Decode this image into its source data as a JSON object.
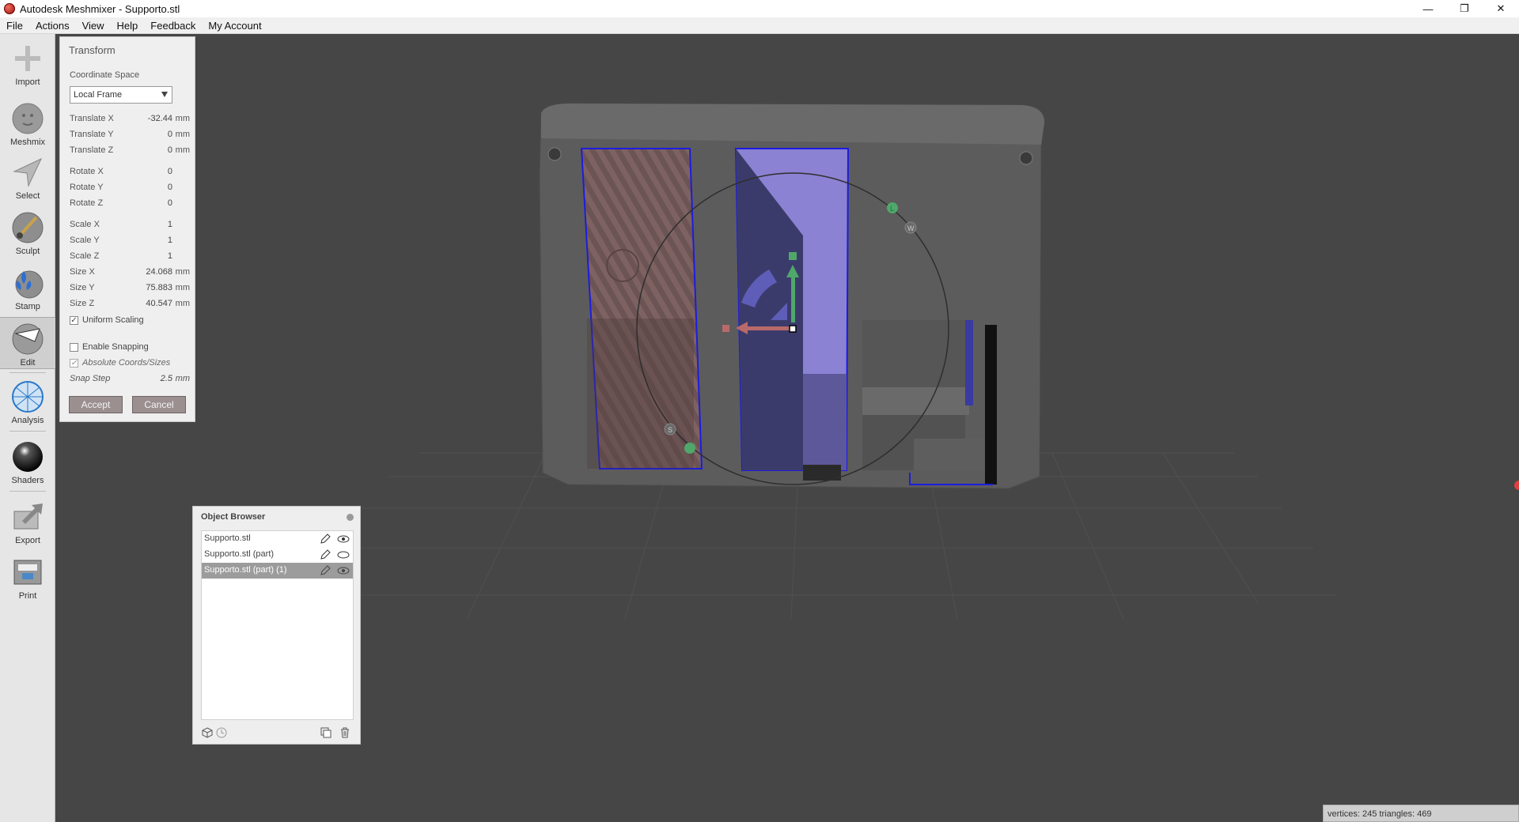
{
  "window": {
    "title": "Autodesk Meshmixer - Supporto.stl",
    "minimize": "—",
    "restore": "❐",
    "close": "✕"
  },
  "menu": [
    "File",
    "Actions",
    "View",
    "Help",
    "Feedback",
    "My Account"
  ],
  "toolbar": {
    "items": [
      {
        "label": "Import",
        "icon": "plus-icon"
      },
      {
        "label": "Meshmix",
        "icon": "face-sphere-icon"
      },
      {
        "label": "Select",
        "icon": "arrow-cursor-icon"
      },
      {
        "label": "Sculpt",
        "icon": "brush-sphere-icon"
      },
      {
        "label": "Stamp",
        "icon": "fleur-de-lis-icon"
      },
      {
        "label": "Edit",
        "icon": "edit-sphere-icon",
        "active": true
      },
      {
        "label": "Analysis",
        "icon": "wireframe-sphere-icon"
      },
      {
        "label": "Shaders",
        "icon": "black-sphere-icon"
      },
      {
        "label": "Export",
        "icon": "export-arrow-icon"
      },
      {
        "label": "Print",
        "icon": "printer-icon"
      }
    ]
  },
  "transform": {
    "title": "Transform",
    "coordinate_space_label": "Coordinate Space",
    "coordinate_space_value": "Local Frame",
    "rows": [
      {
        "label": "Translate X",
        "value": "-32.44",
        "unit": "mm"
      },
      {
        "label": "Translate Y",
        "value": "0",
        "unit": "mm"
      },
      {
        "label": "Translate Z",
        "value": "0",
        "unit": "mm"
      },
      {
        "label": "Rotate X",
        "value": "0",
        "unit": ""
      },
      {
        "label": "Rotate Y",
        "value": "0",
        "unit": ""
      },
      {
        "label": "Rotate Z",
        "value": "0",
        "unit": ""
      },
      {
        "label": "Scale X",
        "value": "1",
        "unit": ""
      },
      {
        "label": "Scale Y",
        "value": "1",
        "unit": ""
      },
      {
        "label": "Scale Z",
        "value": "1",
        "unit": ""
      },
      {
        "label": "Size X",
        "value": "24.068",
        "unit": "mm"
      },
      {
        "label": "Size Y",
        "value": "75.883",
        "unit": "mm"
      },
      {
        "label": "Size Z",
        "value": "40.547",
        "unit": "mm"
      }
    ],
    "uniform_scaling": {
      "label": "Uniform Scaling",
      "checked": true
    },
    "enable_snapping": {
      "label": "Enable Snapping",
      "checked": false
    },
    "absolute_coords": {
      "label": "Absolute Coords/Sizes",
      "checked": true
    },
    "snap_step": {
      "label": "Snap Step",
      "value": "2.5",
      "unit": "mm"
    },
    "accept": "Accept",
    "cancel": "Cancel"
  },
  "object_browser": {
    "title": "Object Browser",
    "items": [
      {
        "name": "Supporto.stl",
        "selected": false
      },
      {
        "name": "Supporto.stl (part)",
        "selected": false
      },
      {
        "name": "Supporto.stl (part) (1)",
        "selected": true
      }
    ]
  },
  "gizmo": {
    "label_l": "L",
    "label_w": "W",
    "label_s": "S"
  },
  "status": "vertices: 245 triangles: 469",
  "colors": {
    "viewport_bg": "#464646",
    "model_gray": "#5d5d5d",
    "selection_blue": "#1c1ce0",
    "selected_part_fill": "#8b82d3",
    "gizmo_green": "#4fa86a",
    "gizmo_red": "#b86a6a",
    "gizmo_blue": "#5e5eb8"
  }
}
